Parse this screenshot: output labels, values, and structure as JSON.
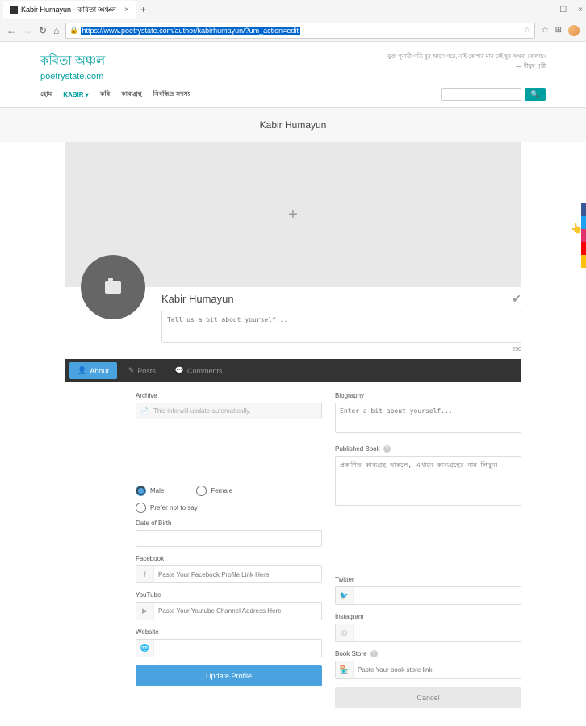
{
  "browser": {
    "tab_title": "Kabir Humayun - কবিতা অঞ্চল",
    "url": "https://www.poetrystate.com/author/kabirhumayun/?um_action=edit"
  },
  "site": {
    "logo_line1": "কবিতা অঞ্চল",
    "logo_line2": "poetrystate.com",
    "tagline": "যুক্ত পুনায়ী গতি ধুর আসে গরে, নাই কোশার মান চাই ধুর অথবা বোলায়।",
    "tagline_author": "— পীযূষ পৃথী"
  },
  "nav": {
    "items": [
      "হোম",
      "KABIR",
      "কবি",
      "কাব্যগ্রন্থ",
      "নিবন্ধিত সদস্য"
    ],
    "active_index": 1
  },
  "page_title": "Kabir Humayun",
  "profile": {
    "name": "Kabir Humayun",
    "bio_placeholder": "Tell us a bit about yourself...",
    "char_limit": "250"
  },
  "tabs": {
    "about": "About",
    "posts": "Posts",
    "comments": "Comments"
  },
  "form": {
    "archive_label": "Archive",
    "archive_placeholder": "This info will update automatically.",
    "biography_label": "Biography",
    "biography_placeholder": "Enter a bit about yourself...",
    "published_book_label": "Published Book",
    "published_book_placeholder": "প্রকাশিত কাব্যগ্রন্থ থাকলে, এখানে কাব্যগ্রন্থের নাম লিখুন।",
    "gender_male": "Male",
    "gender_female": "Female",
    "gender_prefer": "Prefer not to say",
    "dob_label": "Date of Birth",
    "facebook_label": "Facebook",
    "facebook_placeholder": "Paste Your Facebook Profile Link Here",
    "twitter_label": "Twitter",
    "youtube_label": "YouTube",
    "youtube_placeholder": "Paste Your Youtube Channel Address Here",
    "instagram_label": "Instagram",
    "website_label": "Website",
    "bookstore_label": "Book Store",
    "bookstore_placeholder": "Paste Your book store link.",
    "update_btn": "Update Profile",
    "cancel_btn": "Cancel"
  }
}
